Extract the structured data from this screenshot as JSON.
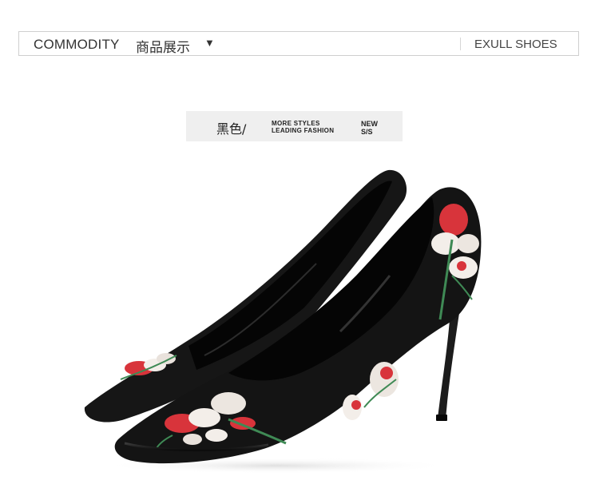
{
  "header": {
    "title_en": "COMMODITY",
    "title_cn": "商品展示",
    "dropdown_glyph": "▼",
    "brand": "EXULL SHOES"
  },
  "color_label": {
    "name": "黑色/",
    "tagline_line1": "MORE STYLES",
    "tagline_line2": "LEADING FASHION",
    "season_line1": "NEW",
    "season_line2": "S/S"
  },
  "product": {
    "icon": "embroidered-pumps-image",
    "colors": {
      "suede": "#141414",
      "embroidery_red": "#d8343b",
      "embroidery_white": "#f3eee9",
      "embroidery_green": "#3f8a55"
    }
  }
}
